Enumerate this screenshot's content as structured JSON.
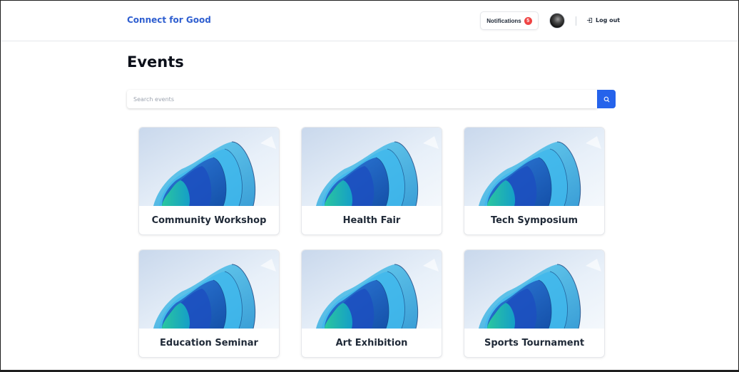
{
  "header": {
    "brand": "Connect for Good",
    "notifications_label": "Notifications",
    "notifications_count": "5",
    "logout_label": "Log out"
  },
  "page": {
    "title": "Events"
  },
  "search": {
    "placeholder": "Search events",
    "value": ""
  },
  "events": [
    {
      "title": "Community Workshop"
    },
    {
      "title": "Health Fair"
    },
    {
      "title": "Tech Symposium"
    },
    {
      "title": "Education Seminar"
    },
    {
      "title": "Art Exhibition"
    },
    {
      "title": "Sports Tournament"
    }
  ],
  "colors": {
    "brand": "#2f5fd0",
    "primary_button": "#2563eb",
    "badge": "#ef4444"
  }
}
